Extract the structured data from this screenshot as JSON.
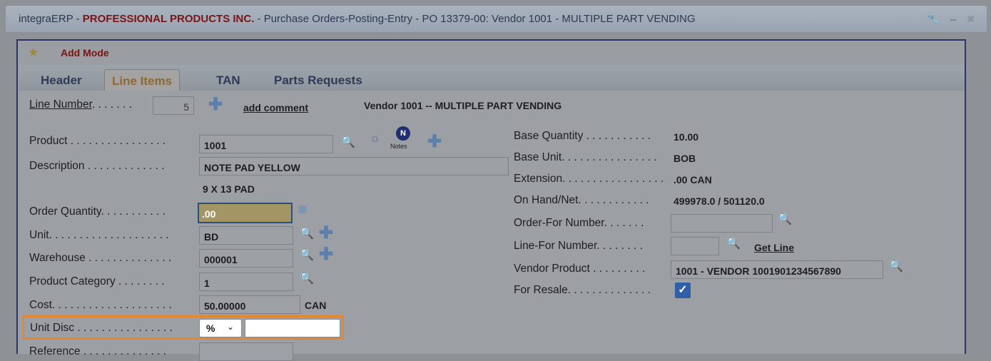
{
  "window": {
    "app": "integraERP",
    "sep1": " - ",
    "company": "PROFESSIONAL PRODUCTS INC.",
    "rest": " - Purchase Orders-Posting-Entry - PO 13379-00: Vendor 1001 - MULTIPLE PART VENDING"
  },
  "mode_label": "Add Mode",
  "tabs": [
    {
      "label": "Header"
    },
    {
      "label": "Line Items"
    },
    {
      "label": "TAN"
    },
    {
      "label": "Parts Requests"
    }
  ],
  "line_number": {
    "label": "Line Number",
    "dots": ". . . . . . .",
    "value": "5"
  },
  "add_comment": "add comment",
  "vendor_heading": "Vendor 1001 -- MULTIPLE PART VENDING",
  "left": {
    "product": {
      "label": "Product . . . . . . . . . . . . . . . .",
      "value": "1001"
    },
    "notes": "Notes",
    "notes_badge": "N",
    "description": {
      "label": "Description . . . . . . . . . . . . .",
      "value": "NOTE PAD YELLOW",
      "value2": "9 X 13 PAD"
    },
    "order_quantity": {
      "label": "Order Quantity. . . . . . . . . . .",
      "value": ".00"
    },
    "unit": {
      "label": "Unit. . . . . . . . . . . . . . . . . . . .",
      "value": "BD"
    },
    "warehouse": {
      "label": "Warehouse . . . . . . . . . . . . . .",
      "value": "000001"
    },
    "product_category": {
      "label": "Product Category . . . . . . . .",
      "value": "1"
    },
    "cost": {
      "label": "Cost. . . . . . . . . . . . . . . . . . . .",
      "value": "50.00000",
      "currency": "CAN"
    },
    "unit_disc": {
      "label": "Unit Disc . . . . . . . . . . . . . . . .",
      "type": "%"
    },
    "reference": {
      "label": "Reference . . . . . . . . . . . . . ."
    }
  },
  "right": {
    "base_quantity": {
      "label": "Base Quantity . . . . . . . . . . .",
      "value": "10.00"
    },
    "base_unit": {
      "label": "Base Unit. . . . . . . . . . . . . . . .",
      "value": "BOB"
    },
    "extension": {
      "label": "Extension. . . . . . . . . . . . . . . . .",
      "value": ".00 CAN"
    },
    "on_hand": {
      "label": "On Hand/Net. . . . . . . . . . . .",
      "value": "499978.0 / 501120.0"
    },
    "order_for": {
      "label": "Order-For Number. . . . . . ."
    },
    "line_for": {
      "label": "Line-For Number. . . . . . . .",
      "link": "Get Line"
    },
    "vendor_product": {
      "label": "Vendor Product . . . . . . . . .",
      "value": "1001 - VENDOR 1001901234567890"
    },
    "for_resale": {
      "label": "For Resale. . . . . . . . . . . . . .",
      "checked": true
    }
  },
  "colors": {
    "highlight": "#e8862e",
    "company": "#7a1414",
    "active_tab": "#8e6733"
  }
}
